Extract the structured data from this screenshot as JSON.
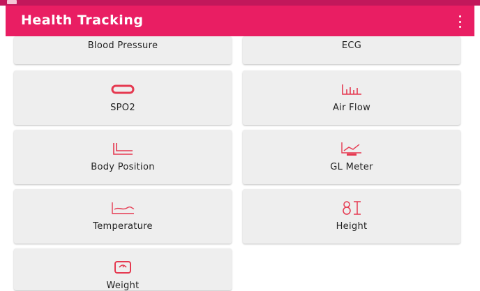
{
  "app": {
    "title": "Health Tracking",
    "accent_color": "#e91e63",
    "statusbar_color": "#c2185b"
  },
  "cards": [
    {
      "label": "Blood Pressure",
      "icon": "blood-pressure-icon"
    },
    {
      "label": "ECG",
      "icon": "ecg-icon"
    },
    {
      "label": "SPO2",
      "icon": "spo2-ring-icon"
    },
    {
      "label": "Air Flow",
      "icon": "air-flow-bars-icon"
    },
    {
      "label": "Body Position",
      "icon": "body-position-icon"
    },
    {
      "label": "GL Meter",
      "icon": "gl-meter-icon"
    },
    {
      "label": "Temperature",
      "icon": "temperature-chart-icon"
    },
    {
      "label": "Height",
      "icon": "height-icon"
    },
    {
      "label": "Weight",
      "icon": "weight-scale-icon"
    }
  ]
}
